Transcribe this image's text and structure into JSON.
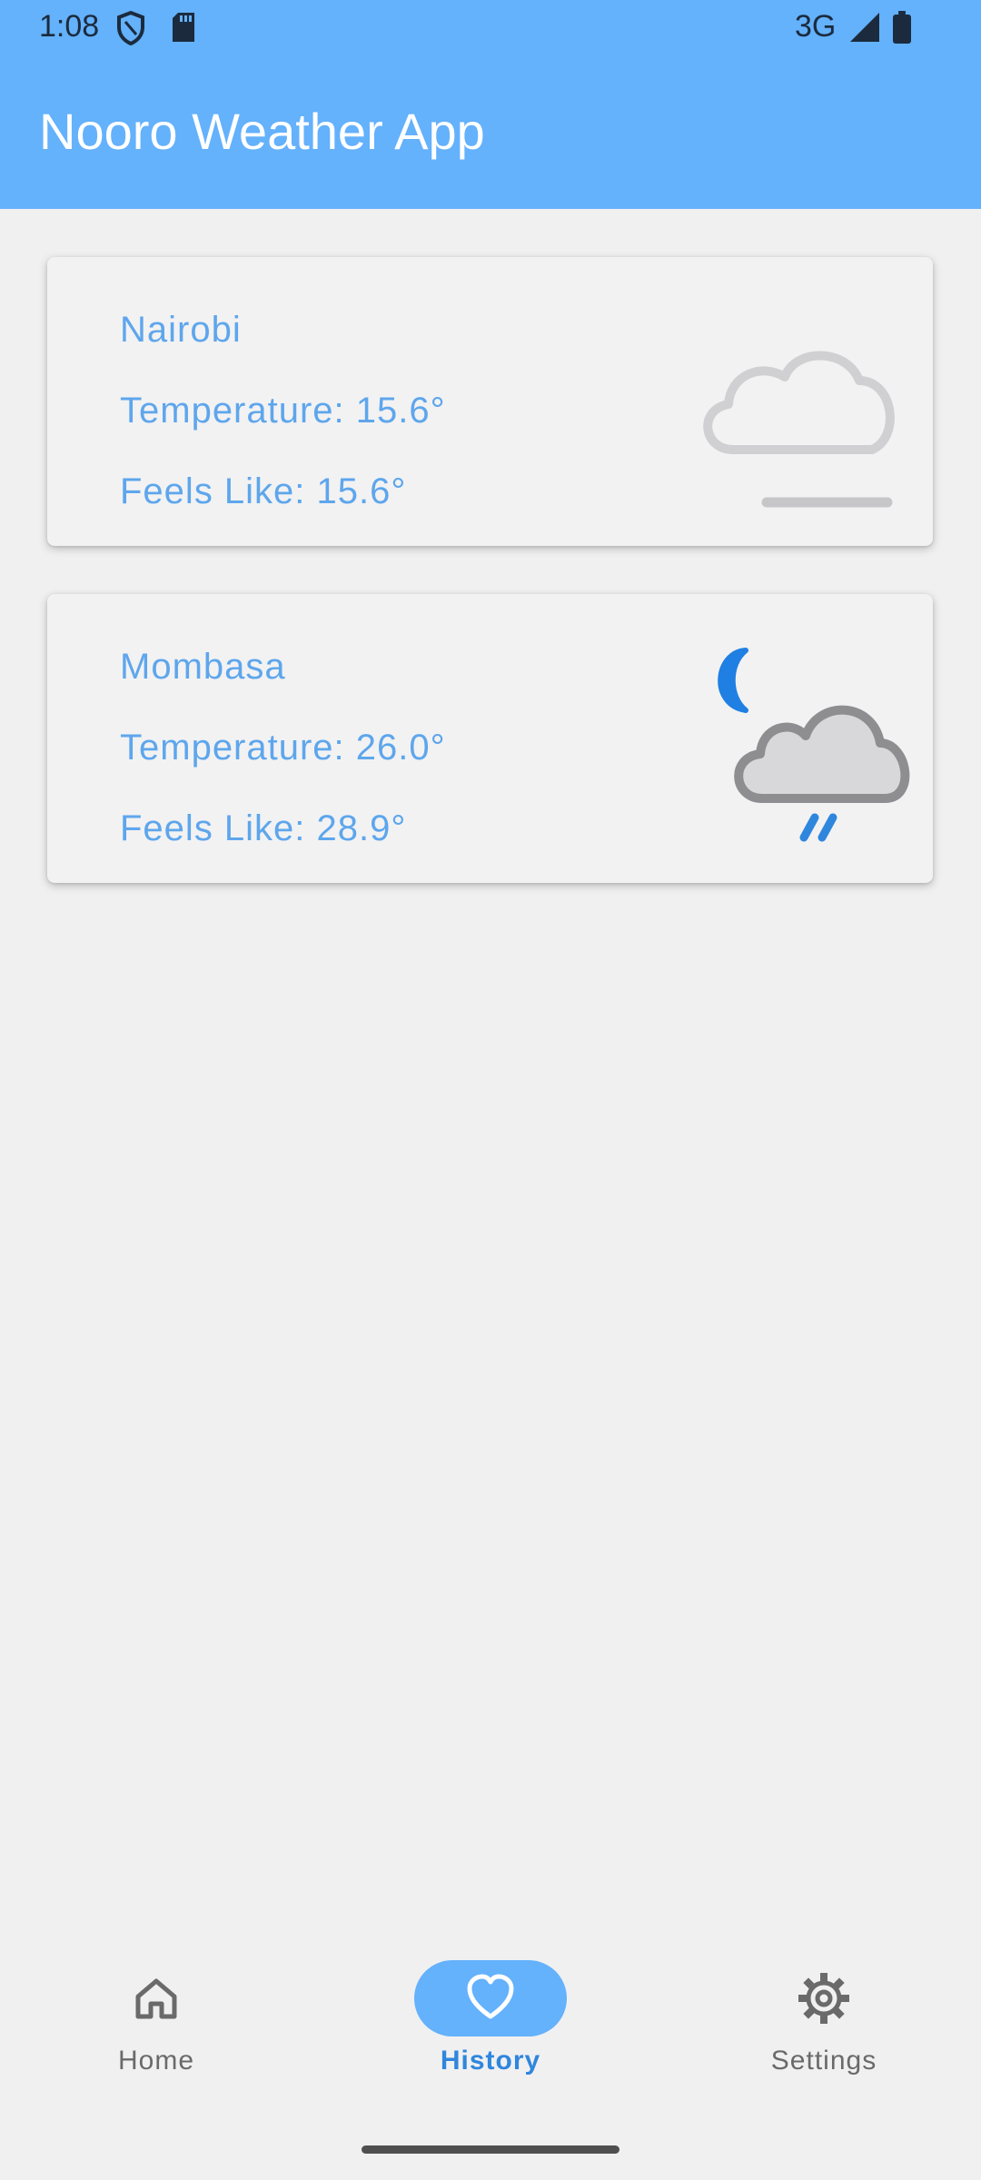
{
  "status_bar": {
    "time": "1:08",
    "network": "3G"
  },
  "app_bar": {
    "title": "Nooro Weather App"
  },
  "cards": [
    {
      "city": "Nairobi",
      "temperature": "Temperature: 15.6°",
      "feels_like": "Feels Like: 15.6°",
      "icon": "fog-cloud-icon"
    },
    {
      "city": "Mombasa",
      "temperature": "Temperature: 26.0°",
      "feels_like": "Feels Like: 28.9°",
      "icon": "night-rain-cloud-icon"
    }
  ],
  "bottom_nav": {
    "active": "History",
    "items": [
      {
        "label": "Home",
        "icon": "home-icon"
      },
      {
        "label": "History",
        "icon": "heart-icon"
      },
      {
        "label": "Settings",
        "icon": "gear-icon"
      }
    ]
  },
  "colors": {
    "app_bar": "#64b1fc",
    "accent_text": "#5ea6ec",
    "active_nav": "#2f86dd",
    "background": "#f0f0f1"
  }
}
